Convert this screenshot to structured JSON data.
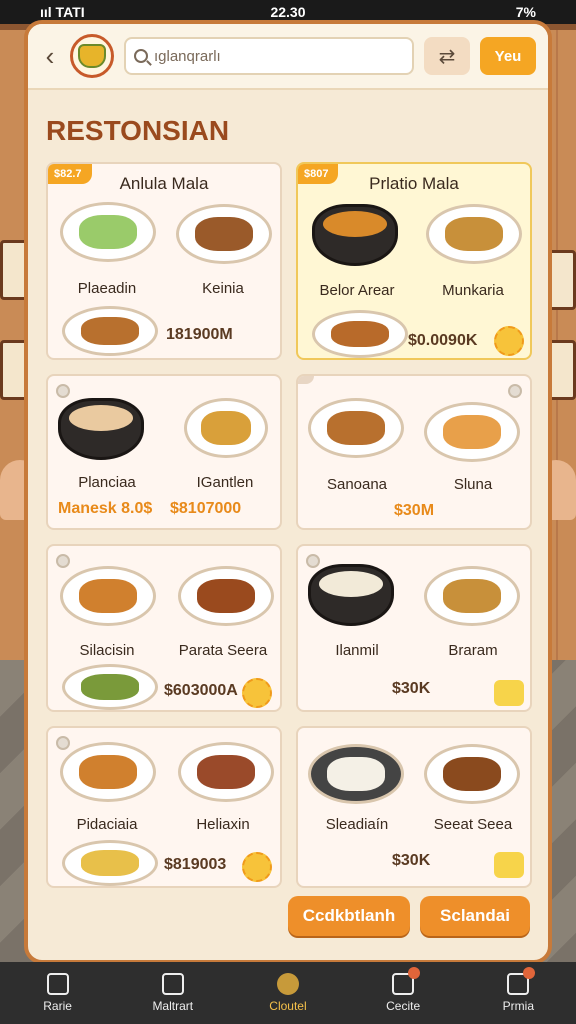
{
  "status": {
    "carrier": "ııl TATI",
    "time": "22.30",
    "battery": "7%"
  },
  "search": {
    "placeholder": "ıglanqrarlı"
  },
  "header": {
    "yes_label": "Yeu",
    "share_icon": "share-icon"
  },
  "page": {
    "title": "RESTONSIAN"
  },
  "cards": [
    {
      "tag": "$82.7",
      "name": "Anlula Mala",
      "left_label": "Plaeadin",
      "right_label": "Keinia",
      "price": "181900M",
      "highlight": false
    },
    {
      "tag": "$807",
      "name": "Prlatio Mala",
      "left_label": "Belor Arear",
      "right_label": "Munkaria",
      "price": "$0.0090K",
      "highlight": true
    },
    {
      "tag": "",
      "name": "",
      "left_label": "Planciaa",
      "right_label": "IGantlen",
      "price": "Manesk 8.0$",
      "price2": "$8107000",
      "highlight": false
    },
    {
      "tag": "",
      "name": "",
      "left_label": "Sanoana",
      "right_label": "Sluna",
      "price": "$30M",
      "highlight": false
    },
    {
      "tag": "",
      "name": "",
      "left_label": "Silacisin",
      "right_label": "Parata Seera",
      "price": "$603000A",
      "highlight": false
    },
    {
      "tag": "",
      "name": "",
      "left_label": "Ilanmil",
      "right_label": "Braram",
      "price": "$30K",
      "highlight": false
    },
    {
      "tag": "",
      "name": "",
      "left_label": "Pidaciaia",
      "right_label": "Heliaxin",
      "price": "$819003",
      "highlight": false
    },
    {
      "tag": "",
      "name": "",
      "left_label": "Sleadiaín",
      "right_label": "Seeat Seea",
      "price": "$30K",
      "highlight": false
    }
  ],
  "actions": {
    "primary": "Ccdkbtlanh",
    "secondary": "Sclandai"
  },
  "nav": [
    {
      "label": "Rarie",
      "icon": "home-icon"
    },
    {
      "label": "Maltrart",
      "icon": "bag-icon"
    },
    {
      "label": "Cloutel",
      "icon": "coin-icon"
    },
    {
      "label": "Cecite",
      "icon": "truck-icon"
    },
    {
      "label": "Prmia",
      "icon": "profile-icon"
    }
  ],
  "colors": {
    "accent": "#f5a623",
    "title": "#9a4a1e",
    "frame": "#c77a3a"
  }
}
